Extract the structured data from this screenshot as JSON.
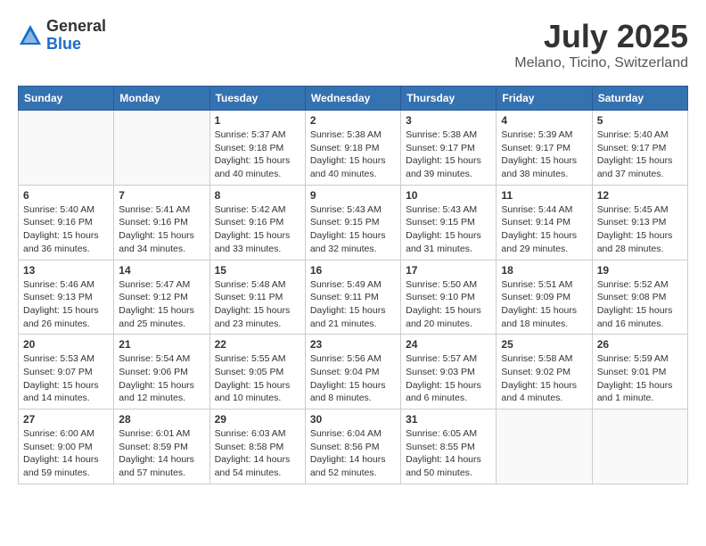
{
  "logo": {
    "general": "General",
    "blue": "Blue"
  },
  "title": "July 2025",
  "subtitle": "Melano, Ticino, Switzerland",
  "days_of_week": [
    "Sunday",
    "Monday",
    "Tuesday",
    "Wednesday",
    "Thursday",
    "Friday",
    "Saturday"
  ],
  "weeks": [
    [
      {
        "day": "",
        "info": ""
      },
      {
        "day": "",
        "info": ""
      },
      {
        "day": "1",
        "info": "Sunrise: 5:37 AM\nSunset: 9:18 PM\nDaylight: 15 hours and 40 minutes."
      },
      {
        "day": "2",
        "info": "Sunrise: 5:38 AM\nSunset: 9:18 PM\nDaylight: 15 hours and 40 minutes."
      },
      {
        "day": "3",
        "info": "Sunrise: 5:38 AM\nSunset: 9:17 PM\nDaylight: 15 hours and 39 minutes."
      },
      {
        "day": "4",
        "info": "Sunrise: 5:39 AM\nSunset: 9:17 PM\nDaylight: 15 hours and 38 minutes."
      },
      {
        "day": "5",
        "info": "Sunrise: 5:40 AM\nSunset: 9:17 PM\nDaylight: 15 hours and 37 minutes."
      }
    ],
    [
      {
        "day": "6",
        "info": "Sunrise: 5:40 AM\nSunset: 9:16 PM\nDaylight: 15 hours and 36 minutes."
      },
      {
        "day": "7",
        "info": "Sunrise: 5:41 AM\nSunset: 9:16 PM\nDaylight: 15 hours and 34 minutes."
      },
      {
        "day": "8",
        "info": "Sunrise: 5:42 AM\nSunset: 9:16 PM\nDaylight: 15 hours and 33 minutes."
      },
      {
        "day": "9",
        "info": "Sunrise: 5:43 AM\nSunset: 9:15 PM\nDaylight: 15 hours and 32 minutes."
      },
      {
        "day": "10",
        "info": "Sunrise: 5:43 AM\nSunset: 9:15 PM\nDaylight: 15 hours and 31 minutes."
      },
      {
        "day": "11",
        "info": "Sunrise: 5:44 AM\nSunset: 9:14 PM\nDaylight: 15 hours and 29 minutes."
      },
      {
        "day": "12",
        "info": "Sunrise: 5:45 AM\nSunset: 9:13 PM\nDaylight: 15 hours and 28 minutes."
      }
    ],
    [
      {
        "day": "13",
        "info": "Sunrise: 5:46 AM\nSunset: 9:13 PM\nDaylight: 15 hours and 26 minutes."
      },
      {
        "day": "14",
        "info": "Sunrise: 5:47 AM\nSunset: 9:12 PM\nDaylight: 15 hours and 25 minutes."
      },
      {
        "day": "15",
        "info": "Sunrise: 5:48 AM\nSunset: 9:11 PM\nDaylight: 15 hours and 23 minutes."
      },
      {
        "day": "16",
        "info": "Sunrise: 5:49 AM\nSunset: 9:11 PM\nDaylight: 15 hours and 21 minutes."
      },
      {
        "day": "17",
        "info": "Sunrise: 5:50 AM\nSunset: 9:10 PM\nDaylight: 15 hours and 20 minutes."
      },
      {
        "day": "18",
        "info": "Sunrise: 5:51 AM\nSunset: 9:09 PM\nDaylight: 15 hours and 18 minutes."
      },
      {
        "day": "19",
        "info": "Sunrise: 5:52 AM\nSunset: 9:08 PM\nDaylight: 15 hours and 16 minutes."
      }
    ],
    [
      {
        "day": "20",
        "info": "Sunrise: 5:53 AM\nSunset: 9:07 PM\nDaylight: 15 hours and 14 minutes."
      },
      {
        "day": "21",
        "info": "Sunrise: 5:54 AM\nSunset: 9:06 PM\nDaylight: 15 hours and 12 minutes."
      },
      {
        "day": "22",
        "info": "Sunrise: 5:55 AM\nSunset: 9:05 PM\nDaylight: 15 hours and 10 minutes."
      },
      {
        "day": "23",
        "info": "Sunrise: 5:56 AM\nSunset: 9:04 PM\nDaylight: 15 hours and 8 minutes."
      },
      {
        "day": "24",
        "info": "Sunrise: 5:57 AM\nSunset: 9:03 PM\nDaylight: 15 hours and 6 minutes."
      },
      {
        "day": "25",
        "info": "Sunrise: 5:58 AM\nSunset: 9:02 PM\nDaylight: 15 hours and 4 minutes."
      },
      {
        "day": "26",
        "info": "Sunrise: 5:59 AM\nSunset: 9:01 PM\nDaylight: 15 hours and 1 minute."
      }
    ],
    [
      {
        "day": "27",
        "info": "Sunrise: 6:00 AM\nSunset: 9:00 PM\nDaylight: 14 hours and 59 minutes."
      },
      {
        "day": "28",
        "info": "Sunrise: 6:01 AM\nSunset: 8:59 PM\nDaylight: 14 hours and 57 minutes."
      },
      {
        "day": "29",
        "info": "Sunrise: 6:03 AM\nSunset: 8:58 PM\nDaylight: 14 hours and 54 minutes."
      },
      {
        "day": "30",
        "info": "Sunrise: 6:04 AM\nSunset: 8:56 PM\nDaylight: 14 hours and 52 minutes."
      },
      {
        "day": "31",
        "info": "Sunrise: 6:05 AM\nSunset: 8:55 PM\nDaylight: 14 hours and 50 minutes."
      },
      {
        "day": "",
        "info": ""
      },
      {
        "day": "",
        "info": ""
      }
    ]
  ]
}
